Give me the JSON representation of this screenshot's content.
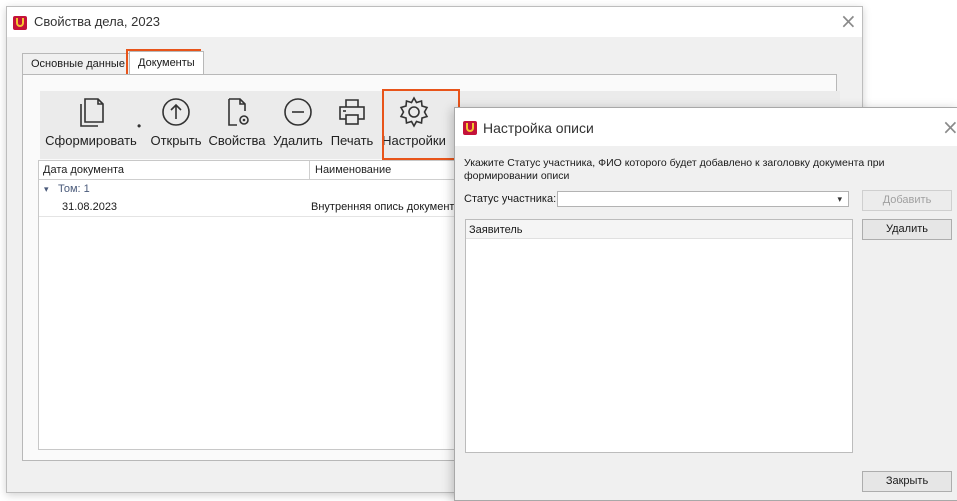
{
  "main_window": {
    "title": "Свойства дела, 2023",
    "close_glyph": "×",
    "tabs": [
      {
        "label": "Основные данные",
        "active": false
      },
      {
        "label": "Документы",
        "active": true
      }
    ],
    "toolbar": [
      {
        "label": "Сформировать",
        "icon": "new-document-icon",
        "has_dropdown": true
      },
      {
        "label": "Открыть",
        "icon": "upload-circle-icon"
      },
      {
        "label": "Свойства",
        "icon": "document-gear-icon"
      },
      {
        "label": "Удалить",
        "icon": "minus-circle-icon"
      },
      {
        "label": "Печать",
        "icon": "printer-icon"
      },
      {
        "label": "Настройки",
        "icon": "gear-icon"
      }
    ],
    "grid": {
      "columns": [
        "Дата документа",
        "Наименование"
      ],
      "group_toggle": "▾",
      "group_label": "Том: 1",
      "rows": [
        {
          "date": "31.08.2023",
          "name": "Внутренняя опись документов"
        }
      ]
    }
  },
  "settings_dialog": {
    "title": "Настройка описи",
    "close_glyph": "×",
    "instruction": "Укажите Статус участника, ФИО которого будет добавлено к заголовку документа при формировании описи",
    "status_label": "Статус участника:",
    "status_value": "",
    "dropdown_arrow": "▾",
    "add_button": "Добавить",
    "delete_button": "Удалить",
    "list_items": [
      "Заявитель"
    ],
    "close_button": "Закрыть"
  },
  "colors": {
    "highlight": "#e8541a",
    "app_icon": "#c4123a",
    "app_icon_accent": "#f4c430"
  }
}
